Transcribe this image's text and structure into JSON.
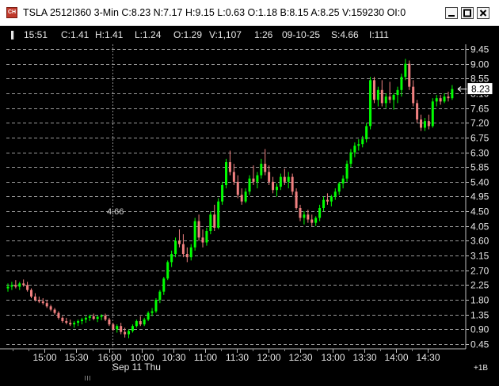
{
  "window": {
    "title": "TSLA 2512I360 3-Min C:8.23 N:7.17 H:9.15 L:0.63 O:1.18 B:8.15 A:8.25 V:159230 OI:0",
    "icon": "chart-app-icon",
    "buttons": [
      "minimize-icon",
      "maximize-icon",
      "close-icon"
    ]
  },
  "info_bar": {
    "time": "15:51",
    "close": "C:1.41",
    "high": "H:1.41",
    "low": "L:1.24",
    "open": "O:1.29",
    "volume": "V:1,107",
    "interval": "1:26",
    "date": "09-10-25",
    "strike": "S:4.66",
    "index": "I:111"
  },
  "chart_data": {
    "type": "candlestick",
    "price_ticks": [
      "9.45",
      "9.00",
      "8.55",
      "8.10",
      "7.65",
      "7.20",
      "6.75",
      "6.30",
      "5.85",
      "5.40",
      "4.95",
      "4.50",
      "4.05",
      "3.60",
      "3.15",
      "2.70",
      "2.25",
      "1.80",
      "1.35",
      "0.90",
      "0.45"
    ],
    "time_ticks": [
      "15:00",
      "15:30",
      "16:00",
      "10:00",
      "10:30",
      "11:00",
      "11:30",
      "12:00",
      "12:30",
      "13:00",
      "13:30",
      "14:00",
      "14:30"
    ],
    "date_label": "Sep 11 Thu",
    "last_price": "8.23",
    "crosshair_price": "4.66",
    "bottom_right_label": "+1B",
    "colors": {
      "up": "#00ff00",
      "down": "#f08080",
      "grid": "#9a9a9a",
      "background": "#000000"
    },
    "series": [
      {
        "t": 0,
        "o": 2.15,
        "h": 2.3,
        "l": 2.05,
        "c": 2.2
      },
      {
        "t": 1,
        "o": 2.2,
        "h": 2.35,
        "l": 2.1,
        "c": 2.25
      },
      {
        "t": 2,
        "o": 2.25,
        "h": 2.4,
        "l": 2.15,
        "c": 2.2
      },
      {
        "t": 3,
        "o": 2.2,
        "h": 2.35,
        "l": 2.1,
        "c": 2.3
      },
      {
        "t": 4,
        "o": 2.3,
        "h": 2.42,
        "l": 2.2,
        "c": 2.25
      },
      {
        "t": 5,
        "o": 2.25,
        "h": 2.35,
        "l": 2.05,
        "c": 2.1
      },
      {
        "t": 6,
        "o": 2.1,
        "h": 2.15,
        "l": 1.85,
        "c": 1.9
      },
      {
        "t": 7,
        "o": 1.9,
        "h": 2.0,
        "l": 1.75,
        "c": 1.8
      },
      {
        "t": 8,
        "o": 1.8,
        "h": 1.9,
        "l": 1.7,
        "c": 1.75
      },
      {
        "t": 9,
        "o": 1.75,
        "h": 1.85,
        "l": 1.65,
        "c": 1.7
      },
      {
        "t": 10,
        "o": 1.7,
        "h": 1.8,
        "l": 1.55,
        "c": 1.6
      },
      {
        "t": 11,
        "o": 1.6,
        "h": 1.65,
        "l": 1.45,
        "c": 1.5
      },
      {
        "t": 12,
        "o": 1.5,
        "h": 1.55,
        "l": 1.35,
        "c": 1.4
      },
      {
        "t": 13,
        "o": 1.4,
        "h": 1.45,
        "l": 1.2,
        "c": 1.25
      },
      {
        "t": 14,
        "o": 1.25,
        "h": 1.3,
        "l": 1.1,
        "c": 1.15
      },
      {
        "t": 15,
        "o": 1.15,
        "h": 1.25,
        "l": 1.05,
        "c": 1.1
      },
      {
        "t": 16,
        "o": 1.1,
        "h": 1.2,
        "l": 1.0,
        "c": 1.05
      },
      {
        "t": 17,
        "o": 1.05,
        "h": 1.15,
        "l": 0.95,
        "c": 1.1
      },
      {
        "t": 18,
        "o": 1.1,
        "h": 1.2,
        "l": 1.0,
        "c": 1.15
      },
      {
        "t": 19,
        "o": 1.15,
        "h": 1.25,
        "l": 1.05,
        "c": 1.2
      },
      {
        "t": 20,
        "o": 1.2,
        "h": 1.3,
        "l": 1.1,
        "c": 1.25
      },
      {
        "t": 21,
        "o": 1.25,
        "h": 1.35,
        "l": 1.15,
        "c": 1.3
      },
      {
        "t": 22,
        "o": 1.3,
        "h": 1.38,
        "l": 1.18,
        "c": 1.22
      },
      {
        "t": 23,
        "o": 1.22,
        "h": 1.32,
        "l": 1.12,
        "c": 1.28
      },
      {
        "t": 24,
        "o": 1.28,
        "h": 1.36,
        "l": 1.18,
        "c": 1.32
      },
      {
        "t": 25,
        "o": 1.32,
        "h": 1.38,
        "l": 1.15,
        "c": 1.2
      },
      {
        "t": 26,
        "o": 1.2,
        "h": 1.25,
        "l": 1.0,
        "c": 1.05
      },
      {
        "t": 27,
        "o": 1.05,
        "h": 1.1,
        "l": 0.85,
        "c": 0.9
      },
      {
        "t": 28,
        "o": 0.9,
        "h": 1.05,
        "l": 0.8,
        "c": 1.0
      },
      {
        "t": 29,
        "o": 1.0,
        "h": 1.1,
        "l": 0.75,
        "c": 0.82
      },
      {
        "t": 30,
        "o": 0.82,
        "h": 0.95,
        "l": 0.65,
        "c": 0.75
      },
      {
        "t": 31,
        "o": 0.75,
        "h": 0.9,
        "l": 0.63,
        "c": 0.85
      },
      {
        "t": 32,
        "o": 0.85,
        "h": 1.05,
        "l": 0.8,
        "c": 1.0
      },
      {
        "t": 33,
        "o": 1.0,
        "h": 1.2,
        "l": 0.95,
        "c": 1.15
      },
      {
        "t": 34,
        "o": 1.15,
        "h": 1.3,
        "l": 1.0,
        "c": 1.05
      },
      {
        "t": 35,
        "o": 1.05,
        "h": 1.25,
        "l": 1.0,
        "c": 1.2
      },
      {
        "t": 36,
        "o": 1.2,
        "h": 1.45,
        "l": 1.15,
        "c": 1.4
      },
      {
        "t": 37,
        "o": 1.4,
        "h": 1.55,
        "l": 1.3,
        "c": 1.45
      },
      {
        "t": 38,
        "o": 1.45,
        "h": 1.85,
        "l": 1.4,
        "c": 1.8
      },
      {
        "t": 39,
        "o": 1.8,
        "h": 2.1,
        "l": 1.7,
        "c": 2.05
      },
      {
        "t": 40,
        "o": 2.05,
        "h": 2.5,
        "l": 1.95,
        "c": 2.45
      },
      {
        "t": 41,
        "o": 2.45,
        "h": 3.0,
        "l": 2.4,
        "c": 2.95
      },
      {
        "t": 42,
        "o": 2.95,
        "h": 3.3,
        "l": 2.8,
        "c": 3.2
      },
      {
        "t": 43,
        "o": 3.2,
        "h": 3.7,
        "l": 3.1,
        "c": 3.6
      },
      {
        "t": 44,
        "o": 3.6,
        "h": 3.95,
        "l": 3.4,
        "c": 3.5
      },
      {
        "t": 45,
        "o": 3.5,
        "h": 3.8,
        "l": 3.1,
        "c": 3.2
      },
      {
        "t": 46,
        "o": 3.2,
        "h": 3.4,
        "l": 2.95,
        "c": 3.1
      },
      {
        "t": 47,
        "o": 3.1,
        "h": 3.5,
        "l": 3.0,
        "c": 3.4
      },
      {
        "t": 48,
        "o": 3.4,
        "h": 4.3,
        "l": 3.3,
        "c": 4.2
      },
      {
        "t": 49,
        "o": 4.2,
        "h": 4.4,
        "l": 3.6,
        "c": 3.7
      },
      {
        "t": 50,
        "o": 3.7,
        "h": 3.95,
        "l": 3.4,
        "c": 3.55
      },
      {
        "t": 51,
        "o": 3.55,
        "h": 4.0,
        "l": 3.45,
        "c": 3.9
      },
      {
        "t": 52,
        "o": 3.9,
        "h": 4.5,
        "l": 3.8,
        "c": 4.4
      },
      {
        "t": 53,
        "o": 4.4,
        "h": 4.7,
        "l": 3.9,
        "c": 4.0
      },
      {
        "t": 54,
        "o": 4.0,
        "h": 4.9,
        "l": 3.95,
        "c": 4.8
      },
      {
        "t": 55,
        "o": 4.8,
        "h": 5.4,
        "l": 4.7,
        "c": 5.3
      },
      {
        "t": 56,
        "o": 5.3,
        "h": 6.1,
        "l": 5.2,
        "c": 6.0
      },
      {
        "t": 57,
        "o": 6.0,
        "h": 6.35,
        "l": 5.6,
        "c": 5.7
      },
      {
        "t": 58,
        "o": 5.7,
        "h": 5.95,
        "l": 5.3,
        "c": 5.4
      },
      {
        "t": 59,
        "o": 5.4,
        "h": 5.6,
        "l": 4.9,
        "c": 5.0
      },
      {
        "t": 60,
        "o": 5.0,
        "h": 5.2,
        "l": 4.7,
        "c": 4.8
      },
      {
        "t": 61,
        "o": 4.8,
        "h": 5.2,
        "l": 4.75,
        "c": 5.1
      },
      {
        "t": 62,
        "o": 5.1,
        "h": 5.6,
        "l": 5.0,
        "c": 5.5
      },
      {
        "t": 63,
        "o": 5.5,
        "h": 5.9,
        "l": 5.3,
        "c": 5.4
      },
      {
        "t": 64,
        "o": 5.4,
        "h": 5.7,
        "l": 5.2,
        "c": 5.6
      },
      {
        "t": 65,
        "o": 5.6,
        "h": 6.1,
        "l": 5.5,
        "c": 5.95
      },
      {
        "t": 66,
        "o": 5.95,
        "h": 6.4,
        "l": 5.6,
        "c": 5.7
      },
      {
        "t": 67,
        "o": 5.7,
        "h": 5.9,
        "l": 5.3,
        "c": 5.4
      },
      {
        "t": 68,
        "o": 5.4,
        "h": 5.55,
        "l": 5.05,
        "c": 5.15
      },
      {
        "t": 69,
        "o": 5.15,
        "h": 5.35,
        "l": 4.95,
        "c": 5.25
      },
      {
        "t": 70,
        "o": 5.25,
        "h": 5.65,
        "l": 5.15,
        "c": 5.55
      },
      {
        "t": 71,
        "o": 5.55,
        "h": 5.8,
        "l": 5.3,
        "c": 5.4
      },
      {
        "t": 72,
        "o": 5.4,
        "h": 5.7,
        "l": 5.2,
        "c": 5.55
      },
      {
        "t": 73,
        "o": 5.55,
        "h": 5.65,
        "l": 5.0,
        "c": 5.1
      },
      {
        "t": 74,
        "o": 5.1,
        "h": 5.2,
        "l": 4.55,
        "c": 4.6
      },
      {
        "t": 75,
        "o": 4.6,
        "h": 4.7,
        "l": 4.2,
        "c": 4.3
      },
      {
        "t": 76,
        "o": 4.3,
        "h": 4.5,
        "l": 4.1,
        "c": 4.4
      },
      {
        "t": 77,
        "o": 4.4,
        "h": 4.55,
        "l": 4.15,
        "c": 4.25
      },
      {
        "t": 78,
        "o": 4.25,
        "h": 4.4,
        "l": 4.05,
        "c": 4.15
      },
      {
        "t": 79,
        "o": 4.15,
        "h": 4.35,
        "l": 4.05,
        "c": 4.3
      },
      {
        "t": 80,
        "o": 4.3,
        "h": 4.7,
        "l": 4.2,
        "c": 4.6
      },
      {
        "t": 81,
        "o": 4.6,
        "h": 4.95,
        "l": 4.5,
        "c": 4.85
      },
      {
        "t": 82,
        "o": 4.85,
        "h": 5.05,
        "l": 4.7,
        "c": 4.8
      },
      {
        "t": 83,
        "o": 4.8,
        "h": 5.0,
        "l": 4.65,
        "c": 4.95
      },
      {
        "t": 84,
        "o": 4.95,
        "h": 5.2,
        "l": 4.85,
        "c": 5.1
      },
      {
        "t": 85,
        "o": 5.1,
        "h": 5.4,
        "l": 5.0,
        "c": 5.35
      },
      {
        "t": 86,
        "o": 5.35,
        "h": 5.6,
        "l": 5.2,
        "c": 5.5
      },
      {
        "t": 87,
        "o": 5.5,
        "h": 6.05,
        "l": 5.4,
        "c": 5.95
      },
      {
        "t": 88,
        "o": 5.95,
        "h": 6.4,
        "l": 5.85,
        "c": 6.3
      },
      {
        "t": 89,
        "o": 6.3,
        "h": 6.6,
        "l": 6.15,
        "c": 6.5
      },
      {
        "t": 90,
        "o": 6.5,
        "h": 6.7,
        "l": 6.35,
        "c": 6.55
      },
      {
        "t": 91,
        "o": 6.55,
        "h": 6.8,
        "l": 6.45,
        "c": 6.7
      },
      {
        "t": 92,
        "o": 6.7,
        "h": 7.2,
        "l": 6.6,
        "c": 7.1
      },
      {
        "t": 93,
        "o": 7.1,
        "h": 8.6,
        "l": 7.0,
        "c": 8.5
      },
      {
        "t": 94,
        "o": 8.5,
        "h": 8.6,
        "l": 7.8,
        "c": 7.9
      },
      {
        "t": 95,
        "o": 7.9,
        "h": 8.3,
        "l": 7.7,
        "c": 8.2
      },
      {
        "t": 96,
        "o": 8.2,
        "h": 8.5,
        "l": 7.7,
        "c": 7.8
      },
      {
        "t": 97,
        "o": 7.8,
        "h": 8.1,
        "l": 7.65,
        "c": 8.0
      },
      {
        "t": 98,
        "o": 8.0,
        "h": 8.45,
        "l": 7.8,
        "c": 7.9
      },
      {
        "t": 99,
        "o": 7.9,
        "h": 8.1,
        "l": 7.6,
        "c": 8.05
      },
      {
        "t": 100,
        "o": 8.05,
        "h": 8.3,
        "l": 7.8,
        "c": 8.2
      },
      {
        "t": 101,
        "o": 8.2,
        "h": 8.7,
        "l": 8.0,
        "c": 8.6
      },
      {
        "t": 102,
        "o": 8.6,
        "h": 9.15,
        "l": 8.5,
        "c": 9.0
      },
      {
        "t": 103,
        "o": 9.0,
        "h": 9.1,
        "l": 8.2,
        "c": 8.3
      },
      {
        "t": 104,
        "o": 8.3,
        "h": 8.5,
        "l": 7.7,
        "c": 7.8
      },
      {
        "t": 105,
        "o": 7.8,
        "h": 7.9,
        "l": 7.2,
        "c": 7.3
      },
      {
        "t": 106,
        "o": 7.3,
        "h": 7.45,
        "l": 6.95,
        "c": 7.05
      },
      {
        "t": 107,
        "o": 7.05,
        "h": 7.35,
        "l": 6.95,
        "c": 7.25
      },
      {
        "t": 108,
        "o": 7.25,
        "h": 7.45,
        "l": 7.0,
        "c": 7.1
      },
      {
        "t": 109,
        "o": 7.1,
        "h": 7.95,
        "l": 7.05,
        "c": 7.85
      },
      {
        "t": 110,
        "o": 7.85,
        "h": 8.05,
        "l": 7.7,
        "c": 7.95
      },
      {
        "t": 111,
        "o": 7.95,
        "h": 8.05,
        "l": 7.75,
        "c": 7.85
      },
      {
        "t": 112,
        "o": 7.85,
        "h": 8.1,
        "l": 7.8,
        "c": 8.0
      },
      {
        "t": 113,
        "o": 8.0,
        "h": 8.15,
        "l": 7.85,
        "c": 7.95
      },
      {
        "t": 114,
        "o": 7.95,
        "h": 8.35,
        "l": 7.9,
        "c": 8.23
      }
    ]
  }
}
